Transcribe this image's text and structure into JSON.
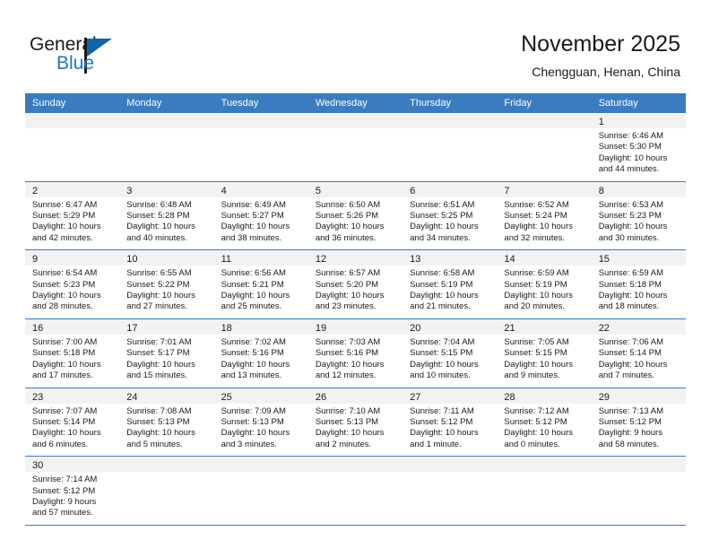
{
  "logo": {
    "text_top": "General",
    "text_bottom": "Blue",
    "icon": "triangle-flag-icon",
    "color_black": "#1a1a1a",
    "color_blue": "#2176bd"
  },
  "header": {
    "title": "November 2025",
    "subtitle": "Chengguan, Henan, China"
  },
  "theme": {
    "header_blue": "#3b7cc0",
    "band_gray": "#f2f2f2",
    "text": "#1a1a1a"
  },
  "weekday_headers": [
    "Sunday",
    "Monday",
    "Tuesday",
    "Wednesday",
    "Thursday",
    "Friday",
    "Saturday"
  ],
  "weeks": [
    [
      {
        "day": "",
        "lines": []
      },
      {
        "day": "",
        "lines": []
      },
      {
        "day": "",
        "lines": []
      },
      {
        "day": "",
        "lines": []
      },
      {
        "day": "",
        "lines": []
      },
      {
        "day": "",
        "lines": []
      },
      {
        "day": "1",
        "lines": [
          "Sunrise: 6:46 AM",
          "Sunset: 5:30 PM",
          "Daylight: 10 hours",
          "and 44 minutes."
        ]
      }
    ],
    [
      {
        "day": "2",
        "lines": [
          "Sunrise: 6:47 AM",
          "Sunset: 5:29 PM",
          "Daylight: 10 hours",
          "and 42 minutes."
        ]
      },
      {
        "day": "3",
        "lines": [
          "Sunrise: 6:48 AM",
          "Sunset: 5:28 PM",
          "Daylight: 10 hours",
          "and 40 minutes."
        ]
      },
      {
        "day": "4",
        "lines": [
          "Sunrise: 6:49 AM",
          "Sunset: 5:27 PM",
          "Daylight: 10 hours",
          "and 38 minutes."
        ]
      },
      {
        "day": "5",
        "lines": [
          "Sunrise: 6:50 AM",
          "Sunset: 5:26 PM",
          "Daylight: 10 hours",
          "and 36 minutes."
        ]
      },
      {
        "day": "6",
        "lines": [
          "Sunrise: 6:51 AM",
          "Sunset: 5:25 PM",
          "Daylight: 10 hours",
          "and 34 minutes."
        ]
      },
      {
        "day": "7",
        "lines": [
          "Sunrise: 6:52 AM",
          "Sunset: 5:24 PM",
          "Daylight: 10 hours",
          "and 32 minutes."
        ]
      },
      {
        "day": "8",
        "lines": [
          "Sunrise: 6:53 AM",
          "Sunset: 5:23 PM",
          "Daylight: 10 hours",
          "and 30 minutes."
        ]
      }
    ],
    [
      {
        "day": "9",
        "lines": [
          "Sunrise: 6:54 AM",
          "Sunset: 5:23 PM",
          "Daylight: 10 hours",
          "and 28 minutes."
        ]
      },
      {
        "day": "10",
        "lines": [
          "Sunrise: 6:55 AM",
          "Sunset: 5:22 PM",
          "Daylight: 10 hours",
          "and 27 minutes."
        ]
      },
      {
        "day": "11",
        "lines": [
          "Sunrise: 6:56 AM",
          "Sunset: 5:21 PM",
          "Daylight: 10 hours",
          "and 25 minutes."
        ]
      },
      {
        "day": "12",
        "lines": [
          "Sunrise: 6:57 AM",
          "Sunset: 5:20 PM",
          "Daylight: 10 hours",
          "and 23 minutes."
        ]
      },
      {
        "day": "13",
        "lines": [
          "Sunrise: 6:58 AM",
          "Sunset: 5:19 PM",
          "Daylight: 10 hours",
          "and 21 minutes."
        ]
      },
      {
        "day": "14",
        "lines": [
          "Sunrise: 6:59 AM",
          "Sunset: 5:19 PM",
          "Daylight: 10 hours",
          "and 20 minutes."
        ]
      },
      {
        "day": "15",
        "lines": [
          "Sunrise: 6:59 AM",
          "Sunset: 5:18 PM",
          "Daylight: 10 hours",
          "and 18 minutes."
        ]
      }
    ],
    [
      {
        "day": "16",
        "lines": [
          "Sunrise: 7:00 AM",
          "Sunset: 5:18 PM",
          "Daylight: 10 hours",
          "and 17 minutes."
        ]
      },
      {
        "day": "17",
        "lines": [
          "Sunrise: 7:01 AM",
          "Sunset: 5:17 PM",
          "Daylight: 10 hours",
          "and 15 minutes."
        ]
      },
      {
        "day": "18",
        "lines": [
          "Sunrise: 7:02 AM",
          "Sunset: 5:16 PM",
          "Daylight: 10 hours",
          "and 13 minutes."
        ]
      },
      {
        "day": "19",
        "lines": [
          "Sunrise: 7:03 AM",
          "Sunset: 5:16 PM",
          "Daylight: 10 hours",
          "and 12 minutes."
        ]
      },
      {
        "day": "20",
        "lines": [
          "Sunrise: 7:04 AM",
          "Sunset: 5:15 PM",
          "Daylight: 10 hours",
          "and 10 minutes."
        ]
      },
      {
        "day": "21",
        "lines": [
          "Sunrise: 7:05 AM",
          "Sunset: 5:15 PM",
          "Daylight: 10 hours",
          "and 9 minutes."
        ]
      },
      {
        "day": "22",
        "lines": [
          "Sunrise: 7:06 AM",
          "Sunset: 5:14 PM",
          "Daylight: 10 hours",
          "and 7 minutes."
        ]
      }
    ],
    [
      {
        "day": "23",
        "lines": [
          "Sunrise: 7:07 AM",
          "Sunset: 5:14 PM",
          "Daylight: 10 hours",
          "and 6 minutes."
        ]
      },
      {
        "day": "24",
        "lines": [
          "Sunrise: 7:08 AM",
          "Sunset: 5:13 PM",
          "Daylight: 10 hours",
          "and 5 minutes."
        ]
      },
      {
        "day": "25",
        "lines": [
          "Sunrise: 7:09 AM",
          "Sunset: 5:13 PM",
          "Daylight: 10 hours",
          "and 3 minutes."
        ]
      },
      {
        "day": "26",
        "lines": [
          "Sunrise: 7:10 AM",
          "Sunset: 5:13 PM",
          "Daylight: 10 hours",
          "and 2 minutes."
        ]
      },
      {
        "day": "27",
        "lines": [
          "Sunrise: 7:11 AM",
          "Sunset: 5:12 PM",
          "Daylight: 10 hours",
          "and 1 minute."
        ]
      },
      {
        "day": "28",
        "lines": [
          "Sunrise: 7:12 AM",
          "Sunset: 5:12 PM",
          "Daylight: 10 hours",
          "and 0 minutes."
        ]
      },
      {
        "day": "29",
        "lines": [
          "Sunrise: 7:13 AM",
          "Sunset: 5:12 PM",
          "Daylight: 9 hours",
          "and 58 minutes."
        ]
      }
    ],
    [
      {
        "day": "30",
        "lines": [
          "Sunrise: 7:14 AM",
          "Sunset: 5:12 PM",
          "Daylight: 9 hours",
          "and 57 minutes."
        ]
      },
      {
        "day": "",
        "lines": []
      },
      {
        "day": "",
        "lines": []
      },
      {
        "day": "",
        "lines": []
      },
      {
        "day": "",
        "lines": []
      },
      {
        "day": "",
        "lines": []
      },
      {
        "day": "",
        "lines": []
      }
    ]
  ]
}
